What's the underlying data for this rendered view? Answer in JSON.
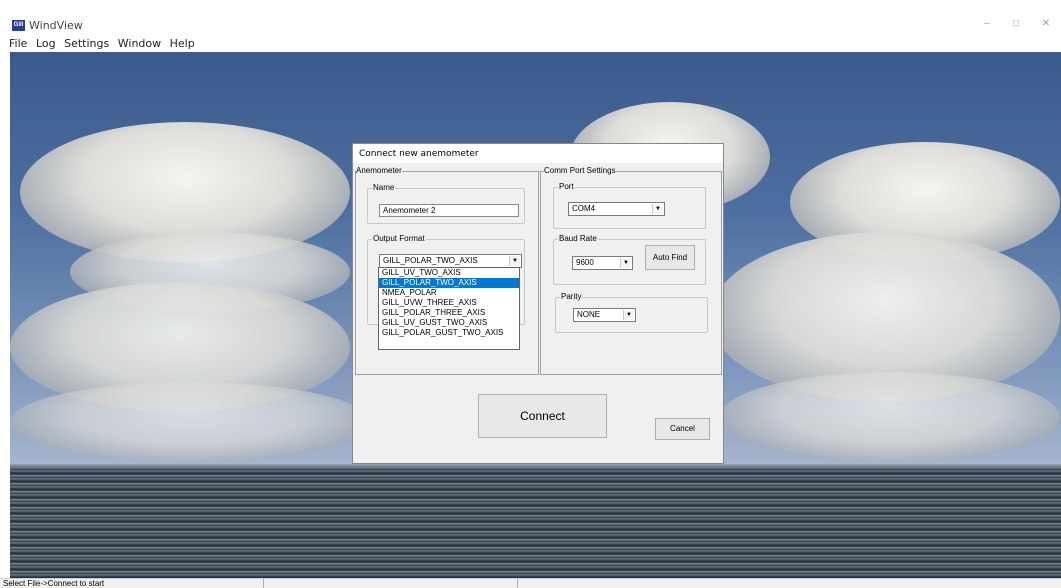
{
  "window": {
    "title": "WindView",
    "logo_text": "Gill",
    "minimize": "–",
    "maximize": "□",
    "close": "✕"
  },
  "menu": [
    "File",
    "Log",
    "Settings",
    "Window",
    "Help"
  ],
  "status": {
    "text": "Select File->Connect to start"
  },
  "dialog": {
    "title": "Connect new anemometer",
    "anemometer_panel": "Anemometer",
    "comm_panel": "Comm Port Settings",
    "name": {
      "label": "Name",
      "value": "Anemometer 2"
    },
    "output_format": {
      "label": "Output Format",
      "selected": "GILL_POLAR_TWO_AXIS",
      "options": [
        "GILL_UV_TWO_AXIS",
        "GILL_POLAR_TWO_AXIS",
        "NMEA_POLAR",
        "GILL_UVW_THREE_AXIS",
        "GILL_POLAR_THREE_AXIS",
        "GILL_UV_GUST_TWO_AXIS",
        "GILL_POLAR_GUST_TWO_AXIS"
      ],
      "highlighted_index": 1
    },
    "port": {
      "label": "Port",
      "value": "COM4"
    },
    "baud": {
      "label": "Baud Rate",
      "value": "9600",
      "auto_find": "Auto Find"
    },
    "parity": {
      "label": "Parity",
      "value": "NONE"
    },
    "connect": "Connect",
    "cancel": "Cancel"
  },
  "colors": {
    "selection": "#0078d7",
    "dialog_bg": "#f0f0f0"
  }
}
